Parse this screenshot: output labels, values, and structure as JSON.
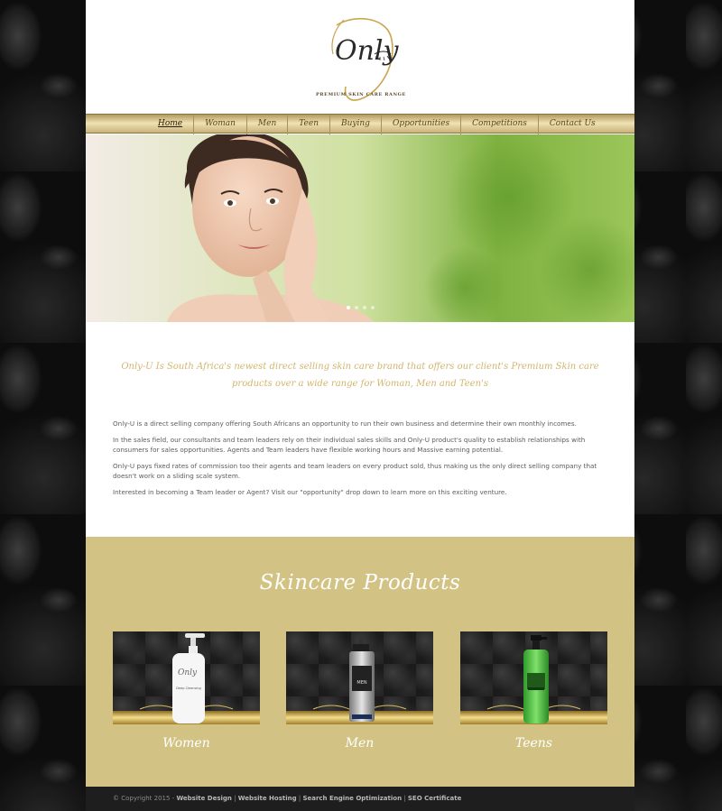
{
  "brand": {
    "name": "Only",
    "tagline": "Premium Skin Care Range"
  },
  "nav": {
    "items": [
      {
        "label": "Home",
        "active": true
      },
      {
        "label": "Woman"
      },
      {
        "label": "Men"
      },
      {
        "label": "Teen"
      },
      {
        "label": "Buying"
      },
      {
        "label": "Opportunities"
      },
      {
        "label": "Competitions"
      },
      {
        "label": "Contact Us"
      }
    ]
  },
  "hero": {
    "slide_count": 4,
    "active_slide": 1
  },
  "intro": {
    "tagline": "Only-U Is South Africa's newest direct selling skin care brand that offers our client's Premium Skin care products over a wide range for Woman, Men and Teen's",
    "paragraphs": [
      "Only-U is a direct selling company offering South Africans an opportunity to run their own business and determine their own monthly incomes.",
      "In the sales field, our consultants and team leaders rely on their individual sales skills and Only-U product's quality to establish relationships with consumers for sales opportunities. Agents and Team leaders have flexible working hours and Massive earning potential.",
      "Only-U pays fixed rates of commission too their agents and team leaders on every product sold, thus making us the only direct selling company that doesn't work on a sliding scale system.",
      "Interested in becoming a Team leader or Agent? Visit our \"opportunity\" drop down to learn more on this exciting venture."
    ]
  },
  "products": {
    "title": "Skincare Products",
    "items": [
      {
        "label": "Women",
        "bottle_text": "Deep Cleansing"
      },
      {
        "label": "Men",
        "bottle_text": "MEN"
      },
      {
        "label": "Teens",
        "bottle_text": ""
      }
    ]
  },
  "footer": {
    "copyright": "© Copyright 2015 - ",
    "links": [
      "Website Design",
      "Website Hosting",
      "Search Engine Optimization",
      "SEO Certificate"
    ],
    "separator": " | "
  },
  "colors": {
    "gold": "#d2b56e",
    "panel": "#d2c385",
    "footer": "#1e1e1e"
  }
}
